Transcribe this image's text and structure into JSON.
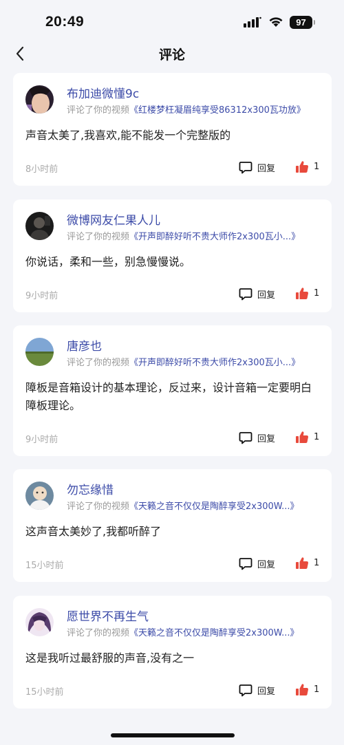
{
  "status_bar": {
    "time": "20:49",
    "battery": "97"
  },
  "nav": {
    "title": "评论"
  },
  "comments": [
    {
      "user": "布加迪微懂9c",
      "prefix": "评论了你的视频",
      "video": "《红楼梦枉凝眉纯享受86312x300瓦功放》",
      "text": "声音太美了,我喜欢,能不能发一个完整版的",
      "time": "8小时前",
      "reply": "回复",
      "likes": "1"
    },
    {
      "user": "微博网友仁果人儿",
      "prefix": "评论了你的视频",
      "video": "《开声即醉好听不贵大师作2x300瓦小...》",
      "text": "你说话，柔和一些，别急慢慢说。",
      "time": "9小时前",
      "reply": "回复",
      "likes": "1"
    },
    {
      "user": "唐彦也",
      "prefix": "评论了你的视频",
      "video": "《开声即醉好听不贵大师作2x300瓦小...》",
      "text": "障板是音箱设计的基本理论，反过来，设计音箱一定要明白障板理论。",
      "time": "9小时前",
      "reply": "回复",
      "likes": "1"
    },
    {
      "user": "勿忘缘惜",
      "prefix": "评论了你的视频",
      "video": "《天籁之音不仅仅是陶醉享受2x300W...》",
      "text": "这声音太美妙了,我都听醉了",
      "time": "15小时前",
      "reply": "回复",
      "likes": "1"
    },
    {
      "user": "愿世界不再生气",
      "prefix": "评论了你的视频",
      "video": "《天籁之音不仅仅是陶醉享受2x300W...》",
      "text": "这是我听过最舒服的声音,没有之一",
      "time": "15小时前",
      "reply": "回复",
      "likes": "1"
    }
  ],
  "colors": {
    "accent": "#3c4ba8",
    "like": "#e84a3c",
    "background": "#f4f5f9"
  },
  "icons": [
    "back-icon",
    "comment-icon",
    "thumbs-up-icon",
    "signal-icon",
    "wifi-icon",
    "battery-icon"
  ]
}
